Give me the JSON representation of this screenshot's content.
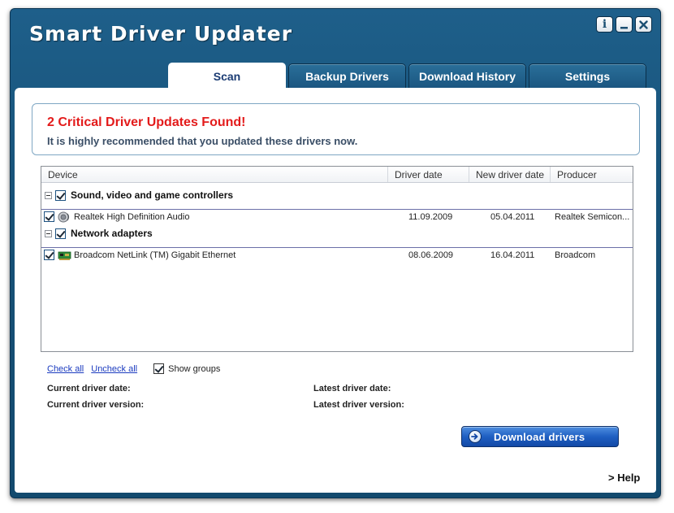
{
  "window": {
    "title": "Smart Driver Updater",
    "buttons": {
      "info": "i"
    }
  },
  "tabs": [
    {
      "label": "Scan",
      "active": true
    },
    {
      "label": "Backup Drivers",
      "active": false
    },
    {
      "label": "Download History",
      "active": false
    },
    {
      "label": "Settings",
      "active": false
    }
  ],
  "alert": {
    "title": "2 Critical Driver Updates Found!",
    "subtitle": "It is highly recommended that you updated these drivers now."
  },
  "grid": {
    "columns": [
      "Device",
      "Driver date",
      "New driver date",
      "Producer"
    ],
    "groups": [
      {
        "label": "Sound, video and game controllers",
        "checked": true,
        "items": [
          {
            "name": "Realtek High Definition Audio",
            "driver_date": "11.09.2009",
            "new_driver_date": "05.04.2011",
            "producer": "Realtek Semicon...",
            "icon": "speaker-icon",
            "checked": true
          }
        ]
      },
      {
        "label": "Network adapters",
        "checked": true,
        "items": [
          {
            "name": "Broadcom NetLink (TM) Gigabit Ethernet",
            "driver_date": "08.06.2009",
            "new_driver_date": "16.04.2011",
            "producer": "Broadcom",
            "icon": "network-card-icon",
            "checked": true
          }
        ]
      }
    ]
  },
  "actions": {
    "check_all": "Check all",
    "uncheck_all": "Uncheck all",
    "show_groups": "Show groups",
    "show_groups_checked": true
  },
  "details": {
    "current_date_label": "Current driver date:",
    "current_version_label": "Current driver version:",
    "latest_date_label": "Latest driver date:",
    "latest_version_label": "Latest driver version:"
  },
  "download_button": "Download drivers",
  "help_link": "> Help",
  "colors": {
    "frame": "#175278",
    "alert_title": "#e31b1b",
    "link": "#1b3bbf",
    "button": "#1f5fc2"
  }
}
